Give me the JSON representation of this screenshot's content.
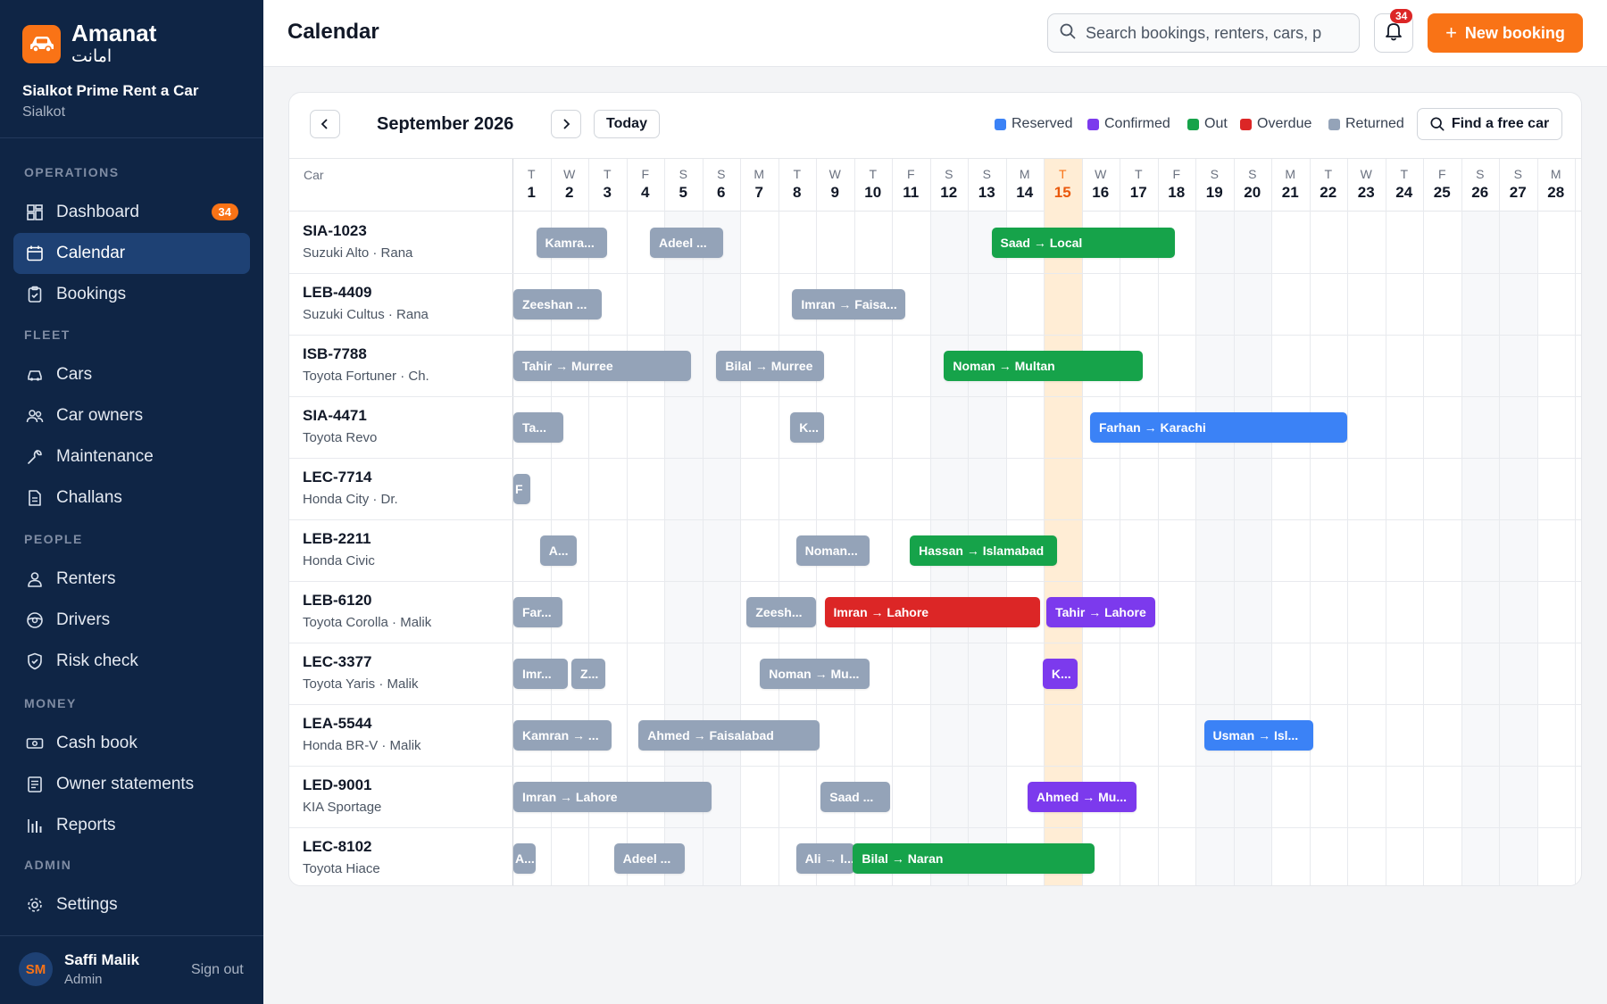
{
  "colors": {
    "sidebar_bg": "#0f2545",
    "accent": "#f97316",
    "reserved": "#3b82f6",
    "confirmed": "#7c3aed",
    "out": "#16a34a",
    "overdue": "#dc2626",
    "returned": "#94a3b8",
    "today_column": "#ffedd5"
  },
  "brand": {
    "name": "Amanat",
    "urdu": "امانت",
    "business": "Sialkot Prime Rent a Car",
    "city": "Sialkot"
  },
  "sidebar": {
    "sections": [
      {
        "label": "OPERATIONS",
        "items": [
          {
            "label": "Dashboard",
            "icon": "dashboard-icon",
            "badge": "34"
          },
          {
            "label": "Calendar",
            "icon": "calendar-icon",
            "active": true
          },
          {
            "label": "Bookings",
            "icon": "clipboard-icon"
          }
        ]
      },
      {
        "label": "FLEET",
        "items": [
          {
            "label": "Cars",
            "icon": "car-icon"
          },
          {
            "label": "Car owners",
            "icon": "owners-icon"
          },
          {
            "label": "Maintenance",
            "icon": "wrench-icon"
          },
          {
            "label": "Challans",
            "icon": "document-icon"
          }
        ]
      },
      {
        "label": "PEOPLE",
        "items": [
          {
            "label": "Renters",
            "icon": "user-icon"
          },
          {
            "label": "Drivers",
            "icon": "steering-wheel-icon"
          },
          {
            "label": "Risk check",
            "icon": "shield-icon"
          }
        ]
      },
      {
        "label": "MONEY",
        "items": [
          {
            "label": "Cash book",
            "icon": "cash-icon"
          },
          {
            "label": "Owner statements",
            "icon": "statement-icon"
          },
          {
            "label": "Reports",
            "icon": "bar-chart-icon"
          }
        ]
      },
      {
        "label": "ADMIN",
        "items": [
          {
            "label": "Settings",
            "icon": "gear-icon"
          }
        ]
      }
    ],
    "user": {
      "initials": "SM",
      "name": "Saffi Malik",
      "role": "Admin",
      "sign_out": "Sign out"
    }
  },
  "header": {
    "title": "Calendar",
    "search_placeholder": "Search bookings, renters, cars, p",
    "notification_count": "34",
    "new_booking": "New booking"
  },
  "calendar": {
    "month": "September 2026",
    "today_label": "Today",
    "today_day": 15,
    "find_free_car": "Find a free car",
    "car_column": "Car",
    "legend": [
      {
        "label": "Reserved",
        "status": "reserved"
      },
      {
        "label": "Confirmed",
        "status": "confirmed"
      },
      {
        "label": "Out",
        "status": "out"
      },
      {
        "label": "Overdue",
        "status": "overdue"
      },
      {
        "label": "Returned",
        "status": "returned"
      }
    ],
    "days": [
      {
        "d": 1,
        "w": "T"
      },
      {
        "d": 2,
        "w": "W"
      },
      {
        "d": 3,
        "w": "T"
      },
      {
        "d": 4,
        "w": "F"
      },
      {
        "d": 5,
        "w": "S"
      },
      {
        "d": 6,
        "w": "S"
      },
      {
        "d": 7,
        "w": "M"
      },
      {
        "d": 8,
        "w": "T"
      },
      {
        "d": 9,
        "w": "W"
      },
      {
        "d": 10,
        "w": "T"
      },
      {
        "d": 11,
        "w": "F"
      },
      {
        "d": 12,
        "w": "S"
      },
      {
        "d": 13,
        "w": "S"
      },
      {
        "d": 14,
        "w": "M"
      },
      {
        "d": 15,
        "w": "T"
      },
      {
        "d": 16,
        "w": "W"
      },
      {
        "d": 17,
        "w": "T"
      },
      {
        "d": 18,
        "w": "F"
      },
      {
        "d": 19,
        "w": "S"
      },
      {
        "d": 20,
        "w": "S"
      },
      {
        "d": 21,
        "w": "M"
      },
      {
        "d": 22,
        "w": "T"
      },
      {
        "d": 23,
        "w": "W"
      },
      {
        "d": 24,
        "w": "T"
      },
      {
        "d": 25,
        "w": "F"
      },
      {
        "d": 26,
        "w": "S"
      },
      {
        "d": 27,
        "w": "S"
      },
      {
        "d": 28,
        "w": "M"
      }
    ],
    "cars": [
      {
        "plate": "SIA-1023",
        "model": "Suzuki Alto · Rana",
        "bookings": [
          {
            "label": "Kamra...",
            "status": "returned",
            "start": 1.6,
            "end": 3.5
          },
          {
            "label": "Adeel ...",
            "status": "returned",
            "start": 4.6,
            "end": 6.55
          },
          {
            "label": "Saad → Local",
            "status": "out",
            "start": 13.6,
            "end": 18.45
          }
        ]
      },
      {
        "plate": "LEB-4409",
        "model": "Suzuki Cultus · Rana",
        "bookings": [
          {
            "label": "Zeeshan ...",
            "status": "returned",
            "start": 1.0,
            "end": 3.35
          },
          {
            "label": "Imran → Faisa...",
            "status": "returned",
            "start": 8.35,
            "end": 11.35
          }
        ]
      },
      {
        "plate": "ISB-7788",
        "model": "Toyota Fortuner · Ch.",
        "bookings": [
          {
            "label": "Tahir → Murree",
            "status": "returned",
            "start": 1.0,
            "end": 5.7
          },
          {
            "label": "Bilal → Murree",
            "status": "returned",
            "start": 6.35,
            "end": 9.2
          },
          {
            "label": "Noman → Multan",
            "status": "out",
            "start": 12.35,
            "end": 17.6
          }
        ]
      },
      {
        "plate": "SIA-4471",
        "model": "Toyota Revo",
        "bookings": [
          {
            "label": "Ta...",
            "status": "returned",
            "start": 1.0,
            "end": 2.35
          },
          {
            "label": "K...",
            "status": "returned",
            "start": 8.3,
            "end": 9.2
          },
          {
            "label": "Farhan → Karachi",
            "status": "reserved",
            "start": 16.2,
            "end": 23.0
          }
        ]
      },
      {
        "plate": "LEC-7714",
        "model": "Honda City · Dr.",
        "bookings": [
          {
            "label": "F",
            "status": "returned",
            "start": 1.0,
            "end": 1.47
          }
        ]
      },
      {
        "plate": "LEB-2211",
        "model": "Honda Civic",
        "bookings": [
          {
            "label": "A...",
            "status": "returned",
            "start": 1.7,
            "end": 2.7
          },
          {
            "label": "Noman...",
            "status": "returned",
            "start": 8.45,
            "end": 10.4
          },
          {
            "label": "Hassan → Islamabad",
            "status": "out",
            "start": 11.45,
            "end": 15.35
          }
        ]
      },
      {
        "plate": "LEB-6120",
        "model": "Toyota Corolla · Malik",
        "bookings": [
          {
            "label": "Far...",
            "status": "returned",
            "start": 1.0,
            "end": 2.32
          },
          {
            "label": "Zeesh...",
            "status": "returned",
            "start": 7.15,
            "end": 9.0
          },
          {
            "label": "Imran → Lahore",
            "status": "overdue",
            "start": 9.2,
            "end": 14.9
          },
          {
            "label": "Tahir → Lahore",
            "status": "confirmed",
            "start": 15.05,
            "end": 17.95
          }
        ]
      },
      {
        "plate": "LEC-3377",
        "model": "Toyota Yaris · Malik",
        "bookings": [
          {
            "label": "Imr...",
            "status": "returned",
            "start": 1.0,
            "end": 2.45
          },
          {
            "label": "Z...",
            "status": "returned",
            "start": 2.53,
            "end": 3.45
          },
          {
            "label": "Noman → Mu...",
            "status": "returned",
            "start": 7.5,
            "end": 10.4
          },
          {
            "label": "K...",
            "status": "confirmed",
            "start": 14.95,
            "end": 15.9
          }
        ]
      },
      {
        "plate": "LEA-5544",
        "model": "Honda BR-V · Malik",
        "bookings": [
          {
            "label": "Kamran → ...",
            "status": "returned",
            "start": 1.0,
            "end": 3.6
          },
          {
            "label": "Ahmed → Faisalabad",
            "status": "returned",
            "start": 4.3,
            "end": 9.1
          },
          {
            "label": "Usman → Isl...",
            "status": "reserved",
            "start": 19.2,
            "end": 22.1
          }
        ]
      },
      {
        "plate": "LED-9001",
        "model": "KIA Sportage",
        "bookings": [
          {
            "label": "Imran → Lahore",
            "status": "returned",
            "start": 1.0,
            "end": 6.25
          },
          {
            "label": "Saad ...",
            "status": "returned",
            "start": 9.1,
            "end": 10.95
          },
          {
            "label": "Ahmed → Mu...",
            "status": "confirmed",
            "start": 14.55,
            "end": 17.45
          }
        ]
      },
      {
        "plate": "LEC-8102",
        "model": "Toyota Hiace",
        "bookings": [
          {
            "label": "A...",
            "status": "returned",
            "start": 1.0,
            "end": 1.6
          },
          {
            "label": "Adeel ...",
            "status": "returned",
            "start": 3.65,
            "end": 5.55
          },
          {
            "label": "Ali → I...",
            "status": "returned",
            "start": 8.45,
            "end": 10.0
          },
          {
            "label": "Bilal → Naran",
            "status": "out",
            "start": 9.95,
            "end": 16.35
          }
        ]
      }
    ]
  }
}
